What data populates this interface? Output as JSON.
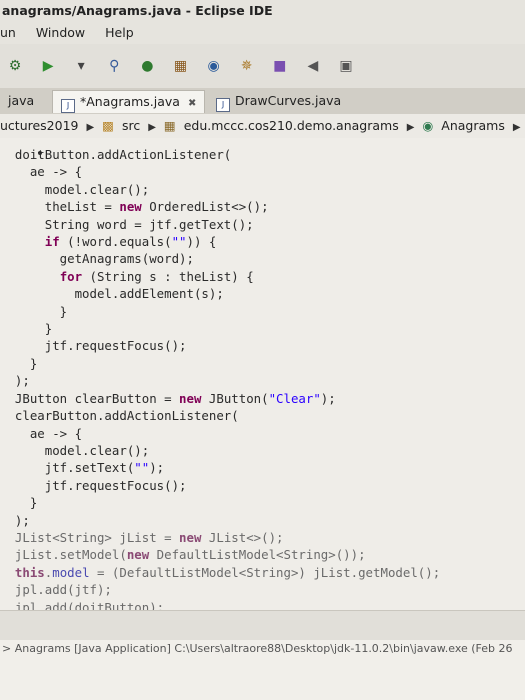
{
  "window": {
    "title": "anagrams/Anagrams.java - Eclipse IDE"
  },
  "menu": {
    "items": [
      "un",
      "Window",
      "Help"
    ]
  },
  "tabs": [
    {
      "label": "java",
      "active": false
    },
    {
      "label": "*Anagrams.java",
      "active": true,
      "close": "✖"
    },
    {
      "label": "DrawCurves.java",
      "active": false
    }
  ],
  "breadcrumb": {
    "items": [
      "uctures2019",
      "src",
      "edu.mccc.cos210.demo.anagrams",
      "Anagrams"
    ]
  },
  "console": {
    "text": "> Anagrams [Java Application] C:\\Users\\altraore88\\Desktop\\jdk-11.0.2\\bin\\javaw.exe (Feb 26"
  },
  "colors": {
    "keyword": "#7f0055",
    "string": "#2a00ff",
    "field": "#0000c0"
  },
  "code": {
    "lines": [
      [
        "  doitButton.addActionListener("
      ],
      [
        "    ae -> {"
      ],
      [
        "      model.clear();"
      ],
      [
        "      theList = ",
        "new",
        " OrderedList<>();"
      ],
      [
        "      String word = jtf.getText();"
      ],
      [
        "      ",
        "if",
        " (!word.equals(",
        "\"\"",
        ")) {"
      ],
      [
        "        getAnagrams(word);"
      ],
      [
        "        ",
        "for",
        " (String s : theList) {"
      ],
      [
        "          model.addElement(s);"
      ],
      [
        "        }"
      ],
      [
        "      }"
      ],
      [
        "      jtf.requestFocus();"
      ],
      [
        "    }"
      ],
      [
        "  );"
      ],
      [
        "  JButton clearButton = ",
        "new",
        " JButton(",
        "\"Clear\"",
        ");"
      ],
      [
        "  clearButton.addActionListener("
      ],
      [
        "    ae -> {"
      ],
      [
        "      model.clear();"
      ],
      [
        "      jtf.setText(",
        "\"\"",
        ");"
      ],
      [
        "      jtf.requestFocus();"
      ],
      [
        "    }"
      ],
      [
        "  );"
      ],
      [
        "  JList<String> jList = ",
        "new",
        " JList<>();"
      ],
      [
        "  jList.setModel(",
        "new",
        " DefaultListModel<String>());"
      ],
      [
        "  ",
        "this",
        ".",
        "model",
        " = (DefaultListModel<String>) jList.getModel();"
      ],
      [
        "  jpl.add(jtf);"
      ],
      [
        "  jpl.add(doitButton);"
      ]
    ]
  }
}
